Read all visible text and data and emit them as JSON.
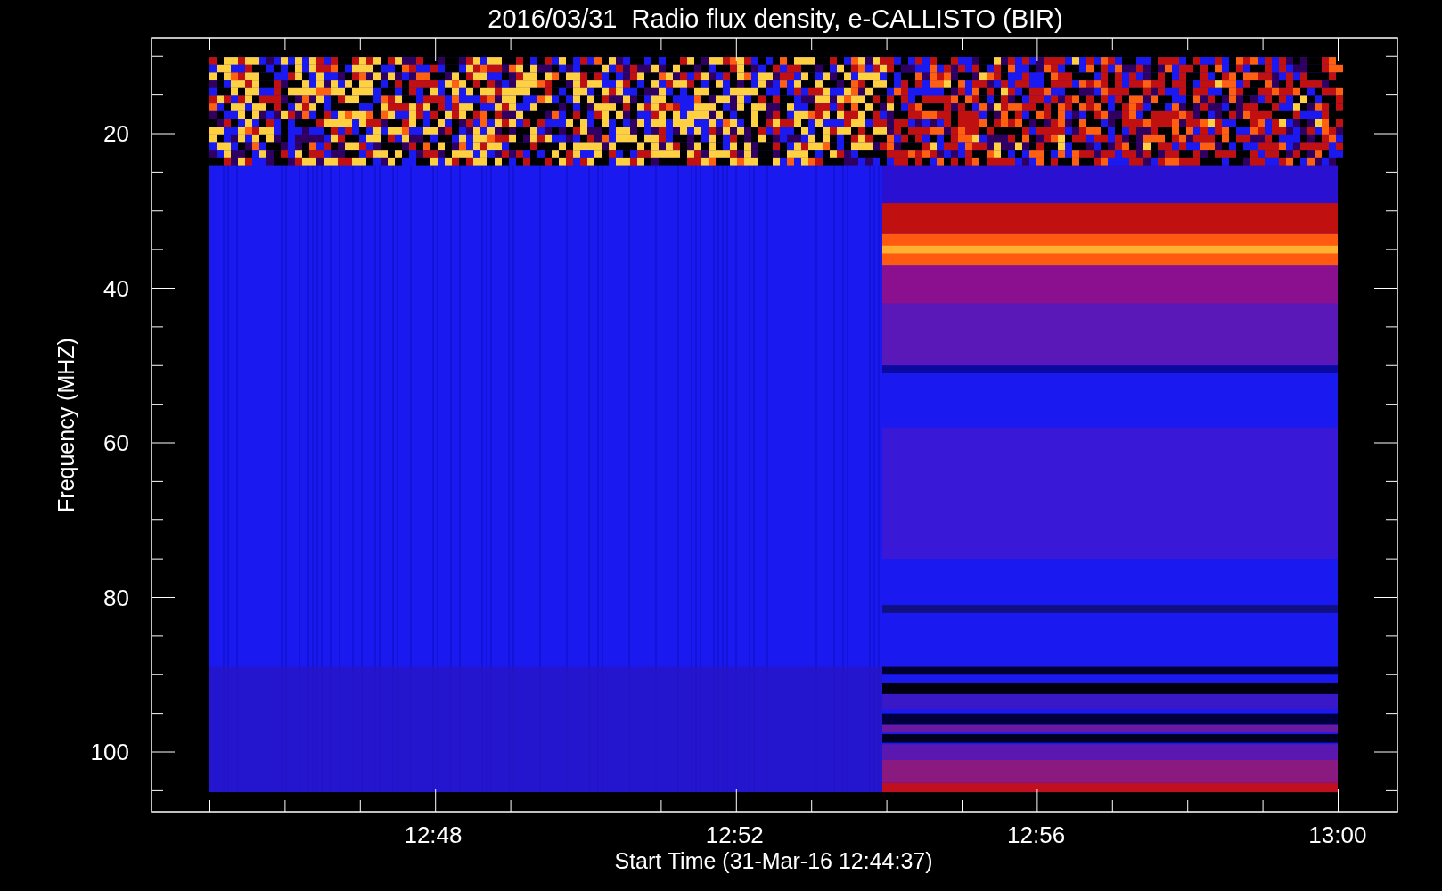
{
  "title": "2016/03/31  Radio flux density, e-CALLISTO (BIR)",
  "y_axis": {
    "label": "Frequency (MHZ)",
    "ticks": [
      "20",
      "40",
      "60",
      "80",
      "100"
    ]
  },
  "x_axis": {
    "label": "Start Time (31-Mar-16 12:44:37)",
    "ticks": [
      "12:48",
      "12:52",
      "12:56",
      "13:00"
    ]
  }
}
